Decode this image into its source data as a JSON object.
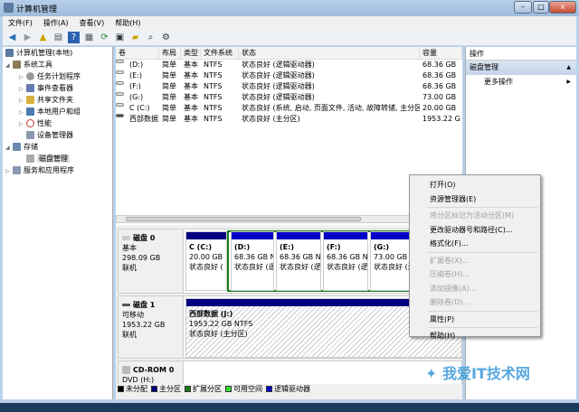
{
  "window": {
    "title": "计算机管理",
    "min": "–",
    "max": "□",
    "close": "x"
  },
  "menu": [
    "文件(F)",
    "操作(A)",
    "查看(V)",
    "帮助(H)"
  ],
  "toolbar": [
    "back-icon",
    "forward-icon",
    "up-icon",
    "show-hide-tree-icon",
    "help-icon",
    "view-icon",
    "refresh-icon",
    "properties-icon",
    "open-icon",
    "search-icon",
    "settings-icon"
  ],
  "tree": [
    {
      "label": "计算机管理(本地)",
      "level": 0
    },
    {
      "label": "系统工具",
      "level": 1,
      "expanded": true
    },
    {
      "label": "任务计划程序",
      "level": 2
    },
    {
      "label": "事件查看器",
      "level": 2
    },
    {
      "label": "共享文件夹",
      "level": 2
    },
    {
      "label": "本地用户和组",
      "level": 2
    },
    {
      "label": "性能",
      "level": 2
    },
    {
      "label": "设备管理器",
      "level": 2
    },
    {
      "label": "存储",
      "level": 1,
      "expanded": true
    },
    {
      "label": "磁盘管理",
      "level": 2,
      "selected": true
    },
    {
      "label": "服务和应用程序",
      "level": 1
    }
  ],
  "volumes": {
    "headers": [
      "卷",
      "布局",
      "类型",
      "文件系统",
      "状态",
      "容量"
    ],
    "rows": [
      [
        "(D:)",
        "简单",
        "基本",
        "NTFS",
        "状态良好 (逻辑驱动器)",
        "68.36 GB"
      ],
      [
        "(E:)",
        "简单",
        "基本",
        "NTFS",
        "状态良好 (逻辑驱动器)",
        "68.36 GB"
      ],
      [
        "(F:)",
        "简单",
        "基本",
        "NTFS",
        "状态良好 (逻辑驱动器)",
        "68.36 GB"
      ],
      [
        "(G:)",
        "简单",
        "基本",
        "NTFS",
        "状态良好 (逻辑驱动器)",
        "73.00 GB"
      ],
      [
        "C (C:)",
        "简单",
        "基本",
        "NTFS",
        "状态良好 (系统, 启动, 页面文件, 活动, 故障转储, 主分区)",
        "20.00 GB"
      ],
      [
        "西部数据 (J:)",
        "简单",
        "基本",
        "NTFS",
        "状态良好 (主分区)",
        "1953.22 G"
      ]
    ]
  },
  "disks": [
    {
      "name": "磁盘 0",
      "type": "基本",
      "size": "298.09 GB",
      "status": "联机",
      "partitions": [
        {
          "name": "C  (C:)",
          "size": "20.00 GB",
          "status": "状态良好 ("
        },
        {
          "name": "(D:)",
          "size": "68.36 GB N",
          "status": "状态良好 (逻"
        },
        {
          "name": "(E:)",
          "size": "68.36 GB N",
          "status": "状态良好 (逻"
        },
        {
          "name": "(F:)",
          "size": "68.36 GB N",
          "status": "状态良好 (逻"
        },
        {
          "name": "(G:)",
          "size": "73.00 GB N",
          "status": "状态良好 (逻"
        }
      ]
    },
    {
      "name": "磁盘 1",
      "type": "可移动",
      "size": "1953.22 GB",
      "status": "联机",
      "partitions": [
        {
          "name": "西部数据  (J:)",
          "size": "1953.22 GB NTFS",
          "status": "状态良好 (主分区)"
        }
      ]
    },
    {
      "name": "CD-ROM 0",
      "type": "DVD (H:)"
    }
  ],
  "legend": [
    {
      "label": "未分配",
      "color": "#000000"
    },
    {
      "label": "主分区",
      "color": "#000080"
    },
    {
      "label": "扩展分区",
      "color": "#1a7a1a"
    },
    {
      "label": "可用空间",
      "color": "#33dd33"
    },
    {
      "label": "逻辑驱动器",
      "color": "#0000c8"
    }
  ],
  "actions": {
    "header": "操作",
    "section": "磁盘管理",
    "more": "更多操作"
  },
  "context_menu": [
    {
      "label": "打开(O)",
      "enabled": true
    },
    {
      "label": "资源管理器(E)",
      "enabled": true
    },
    {
      "sep": true
    },
    {
      "label": "将分区标记为活动分区(M)",
      "enabled": false
    },
    {
      "label": "更改驱动器号和路径(C)...",
      "enabled": true
    },
    {
      "label": "格式化(F)...",
      "enabled": true
    },
    {
      "sep": true
    },
    {
      "label": "扩展卷(X)...",
      "enabled": false
    },
    {
      "label": "压缩卷(H)...",
      "enabled": false
    },
    {
      "label": "添加镜像(A)...",
      "enabled": false
    },
    {
      "label": "删除卷(D)...",
      "enabled": false
    },
    {
      "sep": true
    },
    {
      "label": "属性(P)",
      "enabled": true
    },
    {
      "sep": true
    },
    {
      "label": "帮助(H)",
      "enabled": true
    }
  ],
  "watermark": {
    "text": "我爱IT技术网",
    "url": "www.52ij.com"
  }
}
